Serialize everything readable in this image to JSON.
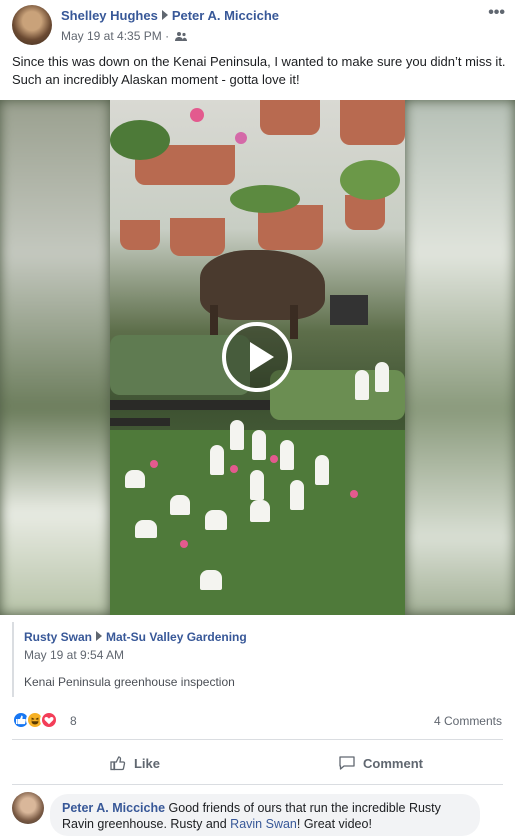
{
  "post": {
    "author": "Shelley Hughes",
    "target": "Peter A. Micciche",
    "timestamp": "May 19 at 4:35 PM",
    "separator": "·",
    "audience_icon": "friends-icon",
    "more_label": "•••",
    "text": "Since this was down on the Kenai Peninsula, I wanted to make sure you didn’t miss it. Such an incredibly Alaskan moment - gotta love it!"
  },
  "shared": {
    "author": "Rusty Swan",
    "group": "Mat-Su Valley Gardening",
    "timestamp": "May 19 at 9:54 AM",
    "description": "Kenai Peninsula greenhouse inspection"
  },
  "stats": {
    "reaction_count": "8",
    "comments": "4 Comments",
    "reaction_icons": [
      "like-reaction-icon",
      "haha-reaction-icon",
      "love-reaction-icon"
    ],
    "colors": {
      "like": "#1877f2",
      "haha": "#f7b125",
      "love": "#f33e58"
    }
  },
  "actions": {
    "like": "Like",
    "comment": "Comment"
  },
  "comment": {
    "author": "Peter A. Micciche",
    "text_part1": " Good friends of ours that run the incredible Rusty Ravin greenhouse. Rusty and ",
    "link": "Ravin Swan",
    "text_part2": "! Great video!"
  },
  "theme": {
    "link_color": "#385898",
    "meta_color": "#616770"
  }
}
